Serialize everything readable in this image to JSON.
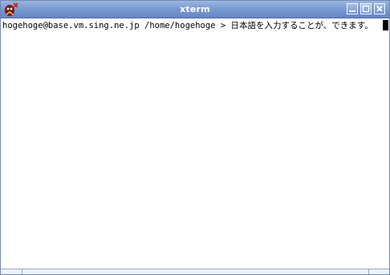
{
  "window": {
    "title": "xterm",
    "app_icon": "xterm-x-icon",
    "controls": {
      "minimize_icon": "minimize-icon",
      "maximize_icon": "maximize-icon",
      "close_icon": "close-icon"
    }
  },
  "terminal": {
    "prompt": "hogehoge@base.vm.sing.ne.jp /home/hogehoge > ",
    "input": "日本語を入力することが、できます。"
  },
  "colors": {
    "titlebar": "#7b9bd2",
    "title_text": "#ffffff",
    "terminal_bg": "#ffffff",
    "terminal_fg": "#000000"
  }
}
